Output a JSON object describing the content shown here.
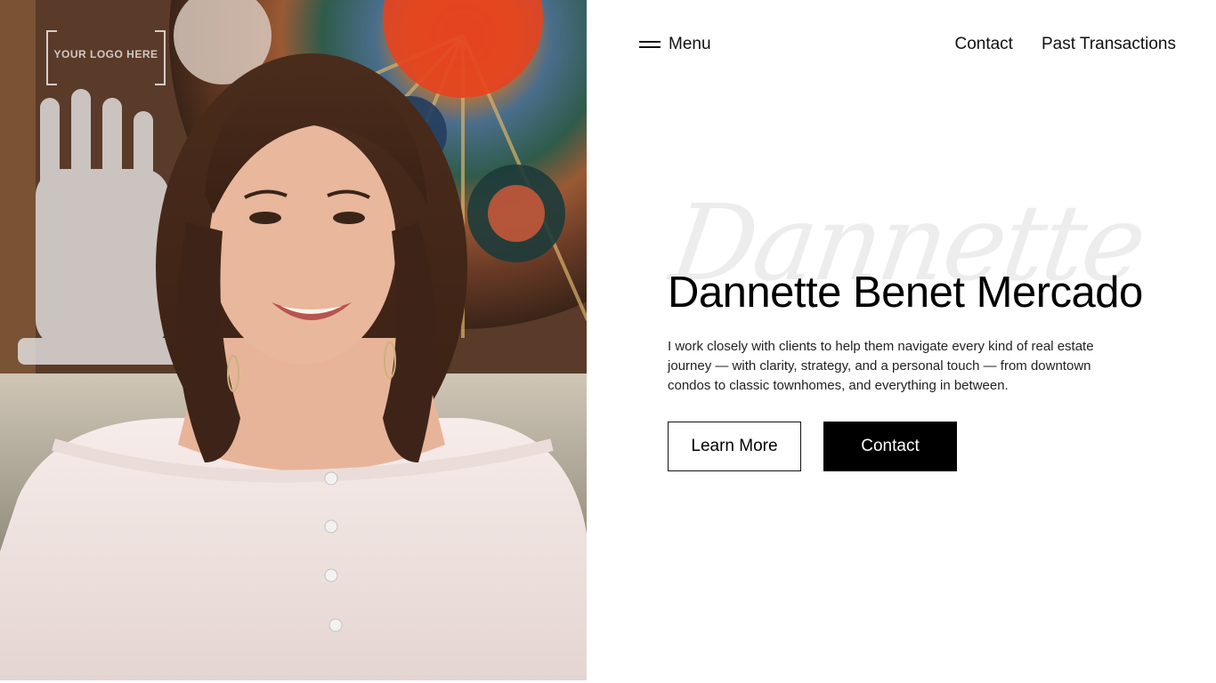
{
  "logo": {
    "text": "YOUR LOGO HERE"
  },
  "nav": {
    "menu_label": "Menu",
    "links": [
      {
        "label": "Contact"
      },
      {
        "label": "Past Transactions"
      }
    ]
  },
  "hero": {
    "script_text": "Dannette",
    "title": "Dannette Benet Mercado",
    "description": "I work closely with clients to help them navigate every kind of real estate journey — with clarity, strategy, and a personal touch — from downtown condos to classic townhomes, and everything in between.",
    "primary_button": "Learn More",
    "secondary_button": "Contact"
  },
  "colors": {
    "background": "#ffffff",
    "text": "#000000",
    "button_solid_bg": "#000000",
    "script_watermark": "#ededed"
  },
  "icons": {
    "menu": "hamburger-icon"
  }
}
